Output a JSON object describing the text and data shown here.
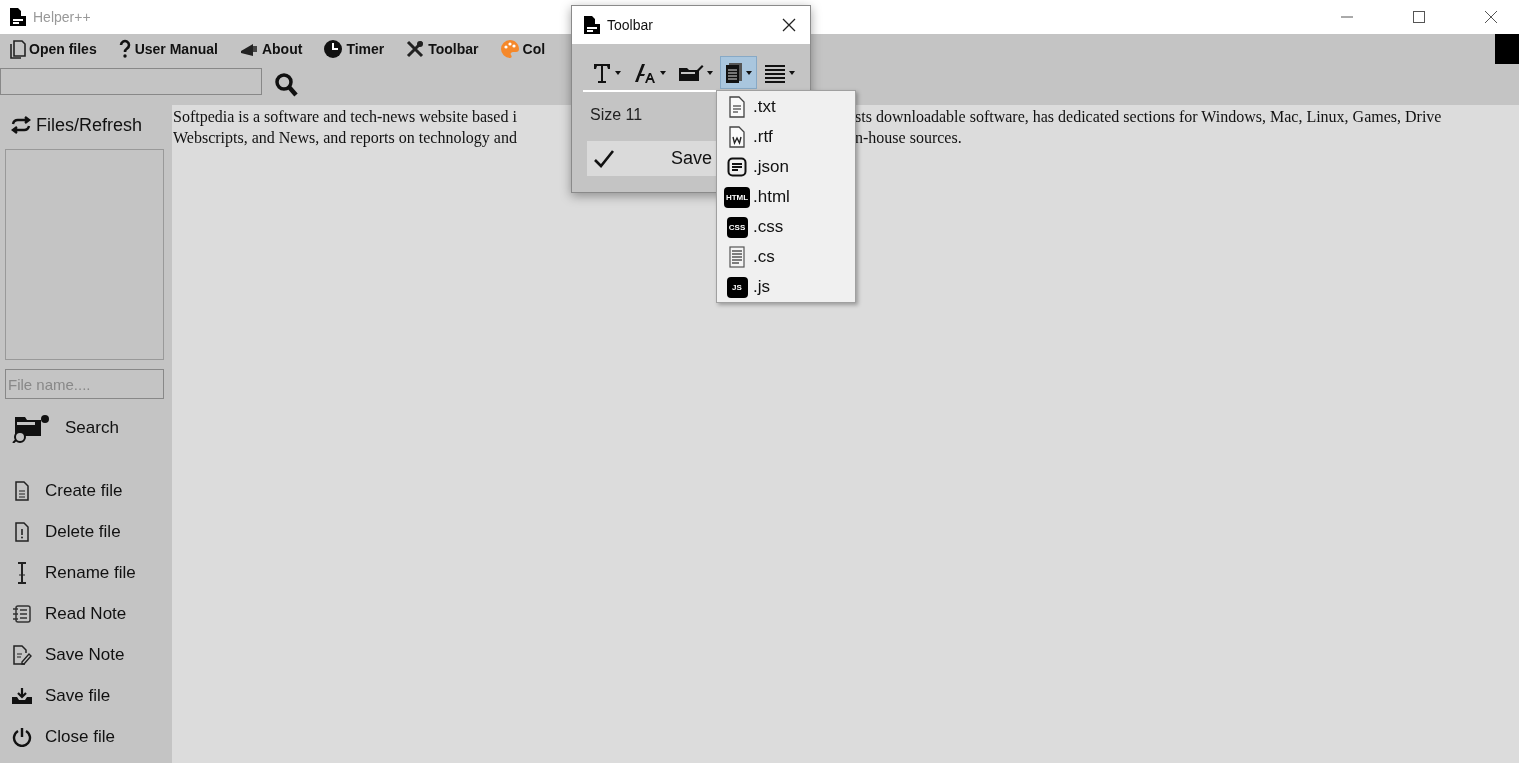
{
  "window": {
    "title": "Helper++"
  },
  "menu": [
    {
      "label": "Open files",
      "kind": "files"
    },
    {
      "label": "User Manual",
      "kind": "help"
    },
    {
      "label": "About",
      "kind": "megaphone"
    },
    {
      "label": "Timer",
      "kind": "clock"
    },
    {
      "label": "Toolbar",
      "kind": "tools"
    },
    {
      "label": "Col",
      "kind": "palette"
    }
  ],
  "sidebar": {
    "refresh": "Files/Refresh",
    "file_name_placeholder": "File name....",
    "search_button": "Search",
    "actions": [
      {
        "label": "Create file",
        "kind": "create"
      },
      {
        "label": "Delete file",
        "kind": "delete"
      },
      {
        "label": "Rename file",
        "kind": "rename"
      },
      {
        "label": "Read Note",
        "kind": "read"
      },
      {
        "label": "Save Note",
        "kind": "savenote"
      },
      {
        "label": "Save file",
        "kind": "savefile"
      },
      {
        "label": "Close file",
        "kind": "close"
      }
    ]
  },
  "editor": {
    "lines": [
      [
        "Softpedia is a software and tech-news website based i",
        "sts downloadable software, has dedicated sections for Windows, Mac, Linux, Games, Drive"
      ],
      [
        "Webscripts, and News, and reports on technology and",
        "n-house sources."
      ]
    ]
  },
  "toolbar_window": {
    "title": "Toolbar",
    "tools": [
      {
        "kind": "font",
        "selected": false
      },
      {
        "kind": "fontsize",
        "selected": false
      },
      {
        "kind": "folder",
        "selected": false
      },
      {
        "kind": "file",
        "selected": true
      },
      {
        "kind": "align",
        "selected": false
      }
    ],
    "size_label": "Size 11",
    "save_button": "Save",
    "file_menu": [
      {
        "label": ".txt",
        "kind": "doc"
      },
      {
        "label": ".rtf",
        "kind": "word"
      },
      {
        "label": ".json",
        "kind": "json"
      },
      {
        "label": ".html",
        "kind": "badge",
        "badge": "HTML"
      },
      {
        "label": ".css",
        "kind": "badge",
        "badge": "CSS"
      },
      {
        "label": ".cs",
        "kind": "lines"
      },
      {
        "label": ".js",
        "kind": "badge",
        "badge": "JS"
      }
    ]
  }
}
